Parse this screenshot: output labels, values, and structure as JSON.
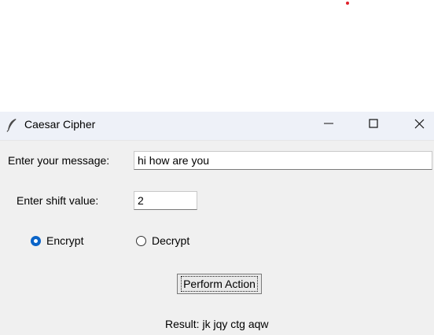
{
  "window": {
    "title": "Caesar Cipher",
    "controls": {
      "minimize_icon": "minimize-icon",
      "maximize_icon": "maximize-icon",
      "close_icon": "close-icon"
    }
  },
  "form": {
    "message_label": "Enter your message:",
    "message_value": "hi how are you",
    "shift_label": "Enter shift value:",
    "shift_value": "2",
    "mode": {
      "options": [
        {
          "label": "Encrypt",
          "selected": true
        },
        {
          "label": "Decrypt",
          "selected": false
        }
      ]
    },
    "action_button": "Perform Action",
    "result_text": "Result: jk jqy ctg aqw"
  },
  "colors": {
    "radio_selected": "#0a64c8",
    "window_bg": "#f0f0f0",
    "titlebar_bg": "#eef1f8",
    "marker_dot": "#e0202a"
  }
}
